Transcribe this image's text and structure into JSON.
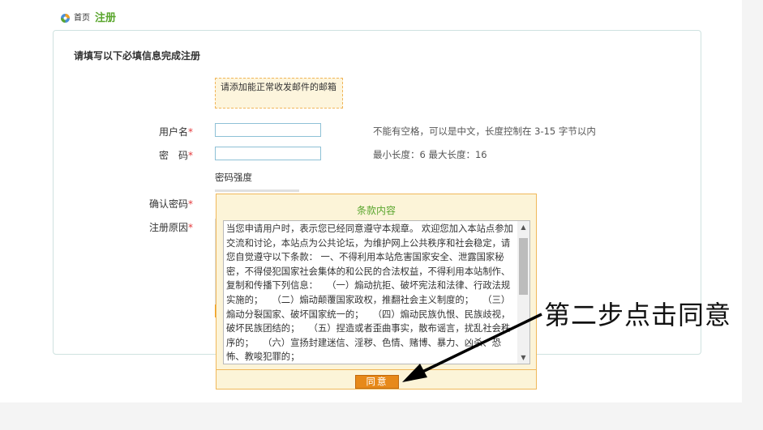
{
  "breadcrumb": {
    "home": "首页",
    "current": "注册"
  },
  "form": {
    "title": "请填写以下必填信息完成注册",
    "notice": "请添加能正常收发邮件的邮箱",
    "username": {
      "label": "用户名",
      "required": "*",
      "value": "",
      "hint": "不能有空格，可以是中文，长度控制在 3-15 字节以内"
    },
    "password": {
      "label": "密　码",
      "required": "*",
      "value": "",
      "hint": "最小长度：6 最大长度：16"
    },
    "strength_label": "密码强度",
    "confirm": {
      "label": "确认密码",
      "required": "*"
    },
    "reason": {
      "label": "注册原因",
      "required": "*"
    }
  },
  "modal": {
    "title": "条款内容",
    "terms": "当您申请用户时，表示您已经同意遵守本规章。 欢迎您加入本站点参加交流和讨论，本站点为公共论坛，为维护网上公共秩序和社会稳定，请您自觉遵守以下条款： 一、不得利用本站危害国家安全、泄露国家秘密，不得侵犯国家社会集体的和公民的合法权益，不得利用本站制作、复制和传播下列信息：　　（一）煽动抗拒、破坏宪法和法律、行政法规实施的；　　（二）煽动颠覆国家政权，推翻社会主义制度的；　　（三）煽动分裂国家、破坏国家统一的；　　（四）煽动民族仇恨、民族歧视，破坏民族团结的；　　（五）捏造或者歪曲事实，散布谣言，扰乱社会秩序的；　　（六）宣扬封建迷信、淫秽、色情、赌博、暴力、凶杀、恐怖、教唆犯罪的；",
    "agree_label": "同意"
  },
  "annotation": {
    "text": "第二步点击同意"
  },
  "colors": {
    "accent_green": "#5aa62e",
    "button_orange": "#e7891a",
    "modal_bg": "#fcf4d8",
    "required_red": "#e4393c"
  },
  "icons": {
    "home": "home-icon",
    "scroll_up": "scroll-up-arrow-icon",
    "scroll_down": "scroll-down-arrow-icon",
    "annotation_arrow": "arrow-icon"
  }
}
